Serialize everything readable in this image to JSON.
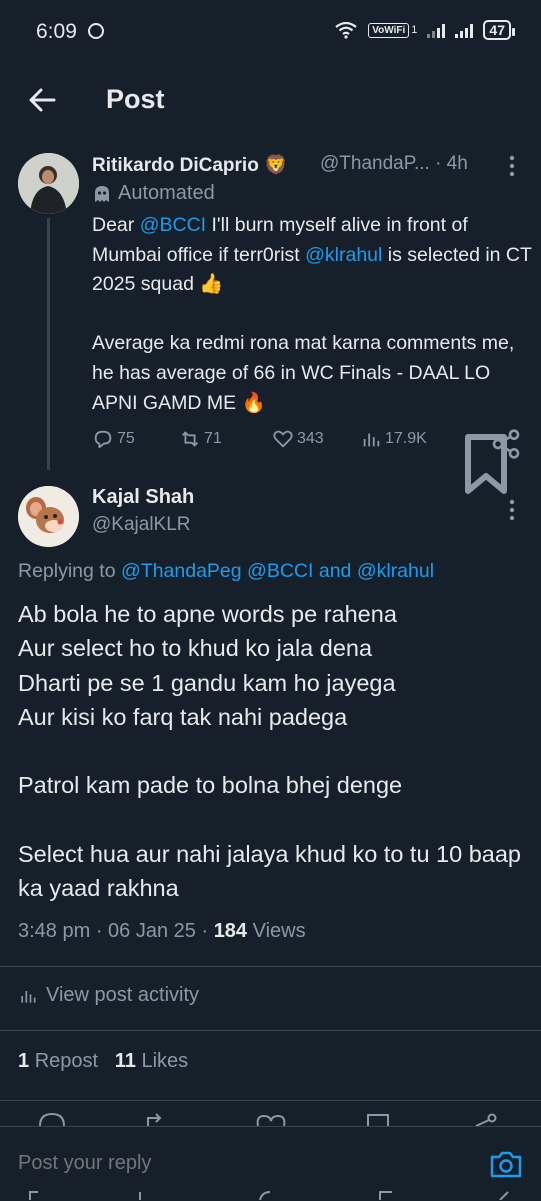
{
  "status_bar": {
    "time": "6:09",
    "vowifi": "VoWiFi",
    "sim_index": "1",
    "battery": "47"
  },
  "header": {
    "title": "Post"
  },
  "post_parent": {
    "author_name": "Ritikardo DiCaprio",
    "author_badge": "🦁",
    "handle": "@ThandaP...",
    "age": "· 4h",
    "automated_label": "Automated",
    "text_segments": [
      {
        "t": "Dear ",
        "m": false
      },
      {
        "t": "@BCCI",
        "m": true
      },
      {
        "t": " I'll burn myself alive in front of Mumbai office if terr0rist ",
        "m": false
      },
      {
        "t": "@klrahul",
        "m": true
      },
      {
        "t": " is selected in CT 2025 squad 👍\n\nAverage ka redmi rona mat karna comments me, he has average of 66 in WC Finals - DAAL LO APNI GAMD ME 🔥",
        "m": false
      }
    ],
    "replies": "75",
    "reposts": "71",
    "likes": "343",
    "views": "17.9K"
  },
  "reply_post": {
    "author_name": "Kajal Shah",
    "handle": "@KajalKLR",
    "replying_prefix": "Replying to ",
    "replying_1": "@ThandaPeg",
    "replying_2": "@BCCI",
    "replying_and": " and ",
    "replying_3": "@klrahul",
    "text": "Ab bola he to apne words pe rahena\nAur select ho to khud ko jala dena\nDharti pe se 1 gandu kam ho jayega\nAur kisi ko farq tak nahi padega\n\nPatrol kam pade to bolna bhej denge\n\nSelect hua aur nahi jalaya khud ko to tu 10 baap ka yaad rakhna",
    "time": "3:48 pm",
    "date": "06 Jan 25",
    "views_count": "184",
    "views_label": "Views",
    "view_activity": "View post activity",
    "repost_count": "1",
    "repost_label": "Repost",
    "likes_count": "11",
    "likes_label": "Likes"
  },
  "reply_bar": {
    "placeholder": "Post your reply"
  },
  "colors": {
    "background": "#15202b",
    "accent": "#1d9bf0",
    "muted": "#8b98a5",
    "text": "#e7e9ea",
    "divider": "#38444d"
  }
}
